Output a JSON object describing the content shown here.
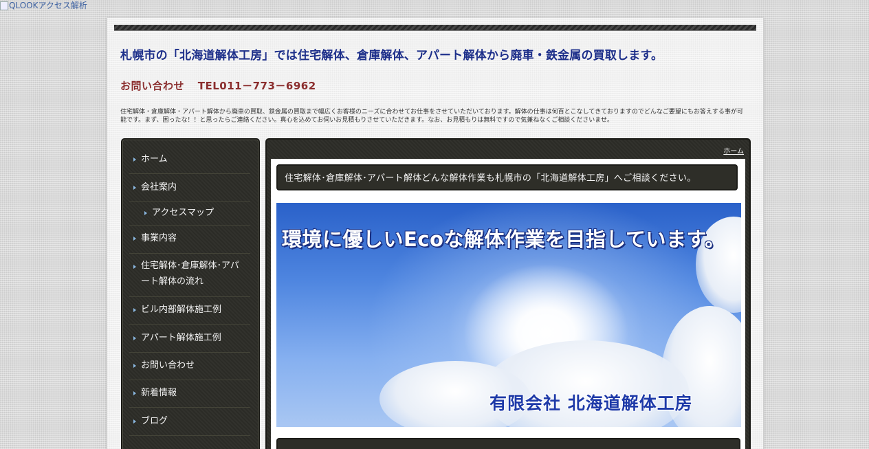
{
  "top_link": {
    "alt_text": "QLOOKアクセス解析"
  },
  "header": {
    "title": "札幌市の「北海道解体工房」では住宅解体、倉庫解体、アパート解体から廃車・鉄金属の買取します。",
    "contact_label": "お問い合わせ",
    "tel": "TEL011－773－6962",
    "description": "住宅解体・倉庫解体・アパート解体から廃車の買取、鉄金属の買取まで幅広くお客様のニーズに合わせてお仕事をさせていただいております。解体の仕事は何百とこなしてきておりますのでどんなご要望にもお答えする事が可能です。まず、困ったな！！と思ったらご連絡ください。真心を込めてお伺いお見積もりさせていただきます。なお、お見積もりは無料ですので気兼ねなくご相談くださいませ。"
  },
  "sidebar": {
    "items": [
      {
        "label": "ホーム"
      },
      {
        "label": "会社案内"
      },
      {
        "label": "アクセスマップ"
      },
      {
        "label": "事業内容"
      },
      {
        "label": "住宅解体･倉庫解体･アパート解体の流れ"
      },
      {
        "label": "ビル内部解体施工例"
      },
      {
        "label": "アパート解体施工例"
      },
      {
        "label": "お問い合わせ"
      },
      {
        "label": "新着情報"
      },
      {
        "label": "ブログ"
      }
    ]
  },
  "main": {
    "breadcrumb": "ホーム",
    "heading": "住宅解体･倉庫解体･アパート解体どんな解体作業も札幌市の「北海道解体工房」へご相談ください。",
    "hero": {
      "slogan": "環境に優しいEcoな解体作業を目指しています。",
      "company": "有限会社 北海道解体工房"
    }
  },
  "colors": {
    "title": "#1d2f8a",
    "contact": "#8b2e2e",
    "panel_dark": "#2b2b26",
    "link": "#3a5fa0"
  }
}
